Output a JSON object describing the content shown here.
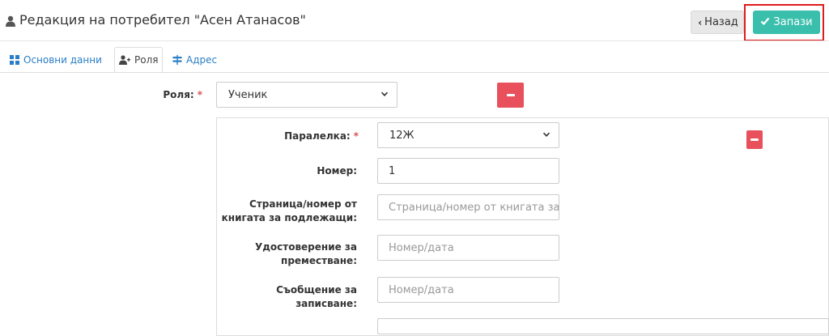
{
  "header": {
    "title": "Редакция на потребител \"Асен Атанасов\"",
    "back_label": "Назад",
    "save_label": "Запази"
  },
  "tabs": [
    {
      "label": "Основни данни",
      "icon": "grid-icon"
    },
    {
      "label": "Роля",
      "icon": "user-plus-icon"
    },
    {
      "label": "Адрес",
      "icon": "signpost-icon"
    }
  ],
  "role": {
    "label": "Роля:",
    "required_mark": "*",
    "value": "Ученик"
  },
  "student": {
    "class_label": "Паралелка:",
    "class_required": "*",
    "class_value": "12Ж",
    "number_label": "Номер:",
    "number_value": "1",
    "page_label_1": "Страница/номер от",
    "page_label_2": "книгата за подлежащи:",
    "page_placeholder": "Страница/номер от книгата за п",
    "transfer_label_1": "Удостоверение за",
    "transfer_label_2": "преместване:",
    "transfer_placeholder": "Номер/дата",
    "enroll_label_1": "Съобщение за",
    "enroll_label_2": "записване:",
    "enroll_placeholder": "Номер/дата"
  },
  "colors": {
    "accent": "#3bbfad",
    "danger": "#e8505b",
    "link": "#2a7ec6",
    "highlight": "#e01b1b"
  }
}
